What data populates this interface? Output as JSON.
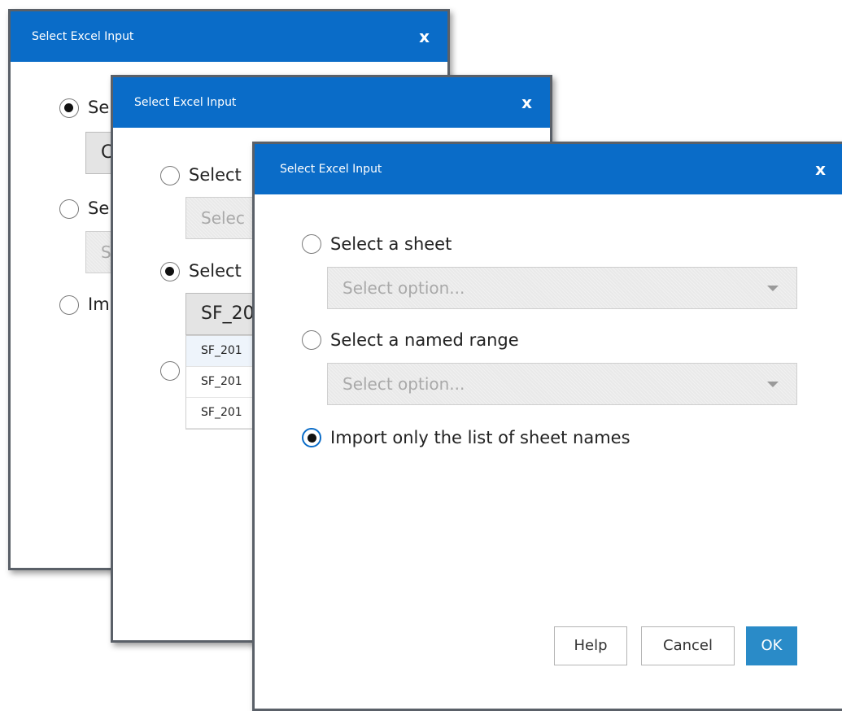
{
  "dialog1": {
    "title": "Select Excel Input",
    "close": "x",
    "opt1": "Se",
    "btn1": "C",
    "opt2": "Se",
    "sel2": "S",
    "opt3": "Im"
  },
  "dialog2": {
    "title": "Select Excel Input",
    "close": "x",
    "opt1": "Select",
    "sel1": "Selec",
    "opt2": "Select",
    "sel2": "SF_20",
    "items": [
      "SF_201",
      "SF_201",
      "SF_201"
    ]
  },
  "dialog3": {
    "title": "Select Excel Input",
    "close": "x",
    "opt_sheet": "Select a sheet",
    "sheet_placeholder": "Select option...",
    "opt_range": "Select a named range",
    "range_placeholder": "Select option...",
    "opt_import": "Import only the list of sheet names",
    "help": "Help",
    "cancel": "Cancel",
    "ok": "OK"
  },
  "colors": {
    "titlebar": "#0a6cc8",
    "primary_button": "#2a8bc8"
  },
  "icons": {
    "close": "close-icon",
    "caret": "chevron-down-icon"
  }
}
